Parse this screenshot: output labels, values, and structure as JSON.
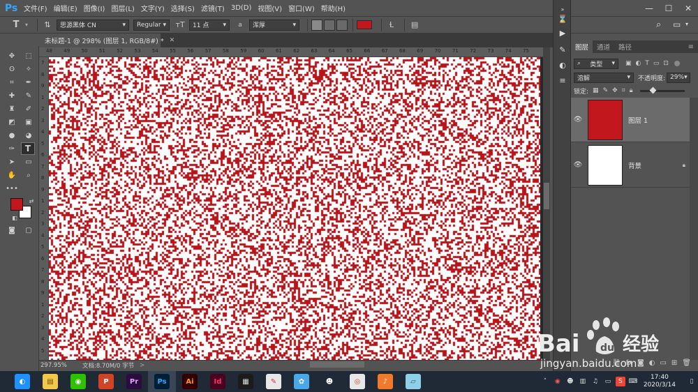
{
  "menubar": {
    "logo": "Ps",
    "items": [
      "文件(F)",
      "编辑(E)",
      "图像(I)",
      "图层(L)",
      "文字(Y)",
      "选择(S)",
      "滤镜(T)",
      "3D(D)",
      "视图(V)",
      "窗口(W)",
      "帮助(H)"
    ],
    "win_min": "—",
    "win_max": "☐",
    "win_close": "✕"
  },
  "options": {
    "tool_glyph": "T",
    "font_family": "思源黑体 CN",
    "font_style": "Regular",
    "font_size": "11 点",
    "aa_label": "a",
    "aa_mode": "浑厚",
    "text_color": "#c2171c"
  },
  "document": {
    "tab_title": "未标题-1 @ 298% (图层 1, RGB/8#) *",
    "ruler_top": [
      "48",
      "49",
      "50",
      "51",
      "52",
      "53",
      "54",
      "55",
      "56",
      "57",
      "58",
      "59",
      "60",
      "61",
      "62",
      "63",
      "64",
      "65",
      "66",
      "67",
      "68",
      "69",
      "70",
      "71",
      "72",
      "73",
      "74",
      "75"
    ],
    "ruler_left": [
      "7",
      "8",
      "9",
      "1",
      "2",
      "3",
      "4",
      "5",
      "6",
      "7",
      "8",
      "9",
      "1",
      "2",
      "3",
      "4",
      "5",
      "6",
      "7",
      "8",
      "9",
      "1",
      "2",
      "3",
      "4",
      "5"
    ],
    "noise_color": "#b8141a",
    "canvas_bg": "#ffffff"
  },
  "status": {
    "zoom": "297.95%",
    "doc_info": "文档:8.70M/0 字节",
    "arrow": ">"
  },
  "colors": {
    "foreground": "#c2171c",
    "background": "#ffffff"
  },
  "layers_panel": {
    "tabs": [
      "图层",
      "通道",
      "路径"
    ],
    "filter_label": "类型",
    "blend_mode": "溶解",
    "opacity_label": "不透明度:",
    "opacity_value": "29%",
    "lock_label": "锁定:",
    "layers": [
      {
        "name": "图层 1",
        "thumb": "#c2171c",
        "selected": true,
        "locked": false
      },
      {
        "name": "背景",
        "thumb": "#ffffff",
        "selected": false,
        "locked": true
      }
    ]
  },
  "taskbar": {
    "apps": [
      {
        "name": "browser-360",
        "glyph": "◐",
        "color": "#1e90ff",
        "fg": "#ffffff"
      },
      {
        "name": "file-explorer",
        "glyph": "▤",
        "color": "#f2c84b",
        "fg": "#6b4b00"
      },
      {
        "name": "wechat",
        "glyph": "◉",
        "color": "#2dc100",
        "fg": "#ffffff"
      },
      {
        "name": "powerpoint",
        "glyph": "P",
        "color": "#d04423",
        "fg": "#ffffff"
      },
      {
        "name": "premiere",
        "glyph": "Pr",
        "color": "#2a0c3f",
        "fg": "#e3a3ff"
      },
      {
        "name": "photoshop",
        "glyph": "Ps",
        "color": "#001e36",
        "fg": "#31a8ff"
      },
      {
        "name": "illustrator",
        "glyph": "Ai",
        "color": "#330000",
        "fg": "#ff9a00"
      },
      {
        "name": "indesign",
        "glyph": "Id",
        "color": "#49021f",
        "fg": "#ff3366"
      },
      {
        "name": "video-player",
        "glyph": "▦",
        "color": "#1b1b1b",
        "fg": "#dddddd"
      },
      {
        "name": "kingsoft",
        "glyph": "✎",
        "color": "#e8e8e8",
        "fg": "#d43030"
      },
      {
        "name": "chat-bird",
        "glyph": "✿",
        "color": "#4aa8e8",
        "fg": "#ffffff"
      },
      {
        "name": "qq",
        "glyph": "☻",
        "color": "#1f2a36",
        "fg": "#ffffff"
      },
      {
        "name": "chrome",
        "glyph": "◎",
        "color": "#e8e8e8",
        "fg": "#db4437"
      },
      {
        "name": "music",
        "glyph": "♪",
        "color": "#f07a2a",
        "fg": "#ffffff"
      },
      {
        "name": "notes",
        "glyph": "▱",
        "color": "#8fd0e8",
        "fg": "#22577a"
      }
    ],
    "clock_time": "17:40",
    "clock_date": "2020/3/14"
  },
  "watermark": {
    "brand": "Bai",
    "brand_tail": "经验",
    "url": "jingyan.baidu.com"
  }
}
